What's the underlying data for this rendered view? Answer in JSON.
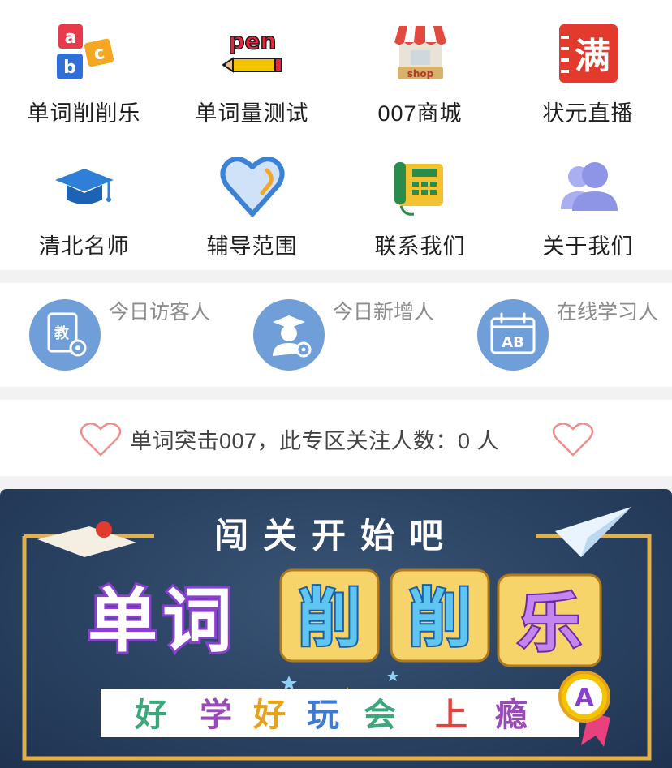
{
  "grid_items": [
    {
      "label": "单词削削乐",
      "icon": "abc-blocks-icon"
    },
    {
      "label": "单词量测试",
      "icon": "pen-icon"
    },
    {
      "label": "007商城",
      "icon": "shop-icon"
    },
    {
      "label": "状元直播",
      "icon": "man-badge-icon"
    },
    {
      "label": "清北名师",
      "icon": "graduation-cap-icon"
    },
    {
      "label": "辅导范围",
      "icon": "heart-outline-icon"
    },
    {
      "label": "联系我们",
      "icon": "telephone-icon"
    },
    {
      "label": "关于我们",
      "icon": "people-icon"
    }
  ],
  "stats": [
    {
      "label": "今日访客人",
      "icon": "textbook-gear-icon",
      "glyph": "教"
    },
    {
      "label": "今日新增人",
      "icon": "teacher-gear-icon"
    },
    {
      "label": "在线学习人",
      "icon": "calendar-ab-icon",
      "glyph": "AB"
    }
  ],
  "follow": {
    "text": "单词突击007，此专区关注人数：0 人"
  },
  "banner": {
    "top_text": "闯关开始吧",
    "title_left": "单词",
    "title_right": [
      "削",
      "削",
      "乐"
    ],
    "tagline": [
      "好",
      "学",
      "好",
      "玩",
      "会",
      "上",
      "瘾"
    ],
    "badge": "A",
    "icon_pen_word": "pen",
    "icon_shop_word": "shop",
    "icon_man_word": "满",
    "colors": {
      "tagline": [
        "#3aa87a",
        "#9a4ab8",
        "#e8a21a",
        "#3d7bd1",
        "#3aa87a",
        "#e0453d",
        "#9a4ab8"
      ]
    }
  }
}
